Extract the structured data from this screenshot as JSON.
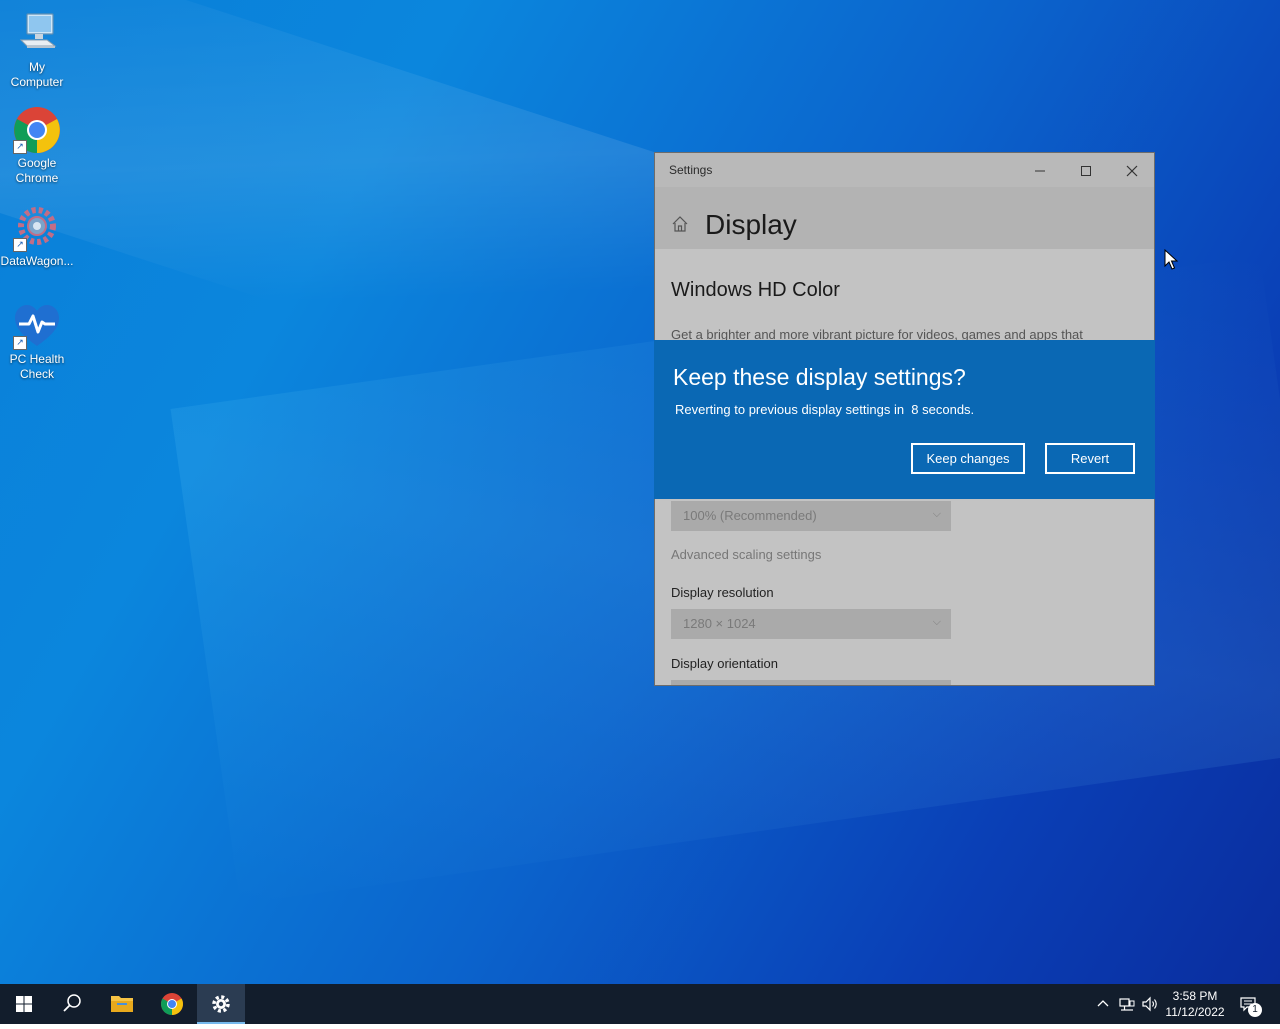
{
  "desktop": {
    "icons": [
      {
        "label": "My\nComputer"
      },
      {
        "label": "Google\nChrome"
      },
      {
        "label": "DataWagon..."
      },
      {
        "label": "PC Health\nCheck"
      }
    ]
  },
  "settings_window": {
    "title": "Settings",
    "page_title": "Display",
    "hd_color_heading": "Windows HD Color",
    "hd_color_desc": "Get a brighter and more vibrant picture for videos, games and apps that",
    "scale_value": "100% (Recommended)",
    "advanced_scaling_link": "Advanced scaling settings",
    "resolution_label": "Display resolution",
    "resolution_value": "1280 × 1024",
    "orientation_label": "Display orientation"
  },
  "dialog": {
    "title": "Keep these display settings?",
    "message": "Reverting to previous display settings in  8 seconds.",
    "keep_label": "Keep changes",
    "revert_label": "Revert",
    "countdown_seconds": 8
  },
  "taskbar": {
    "time": "3:58 PM",
    "date": "11/12/2022",
    "notification_count": "1"
  },
  "colors": {
    "dialog_bg": "#0a68b4",
    "taskbar_bg": "#121d2c",
    "desktop_accent": "#0b86dd"
  }
}
